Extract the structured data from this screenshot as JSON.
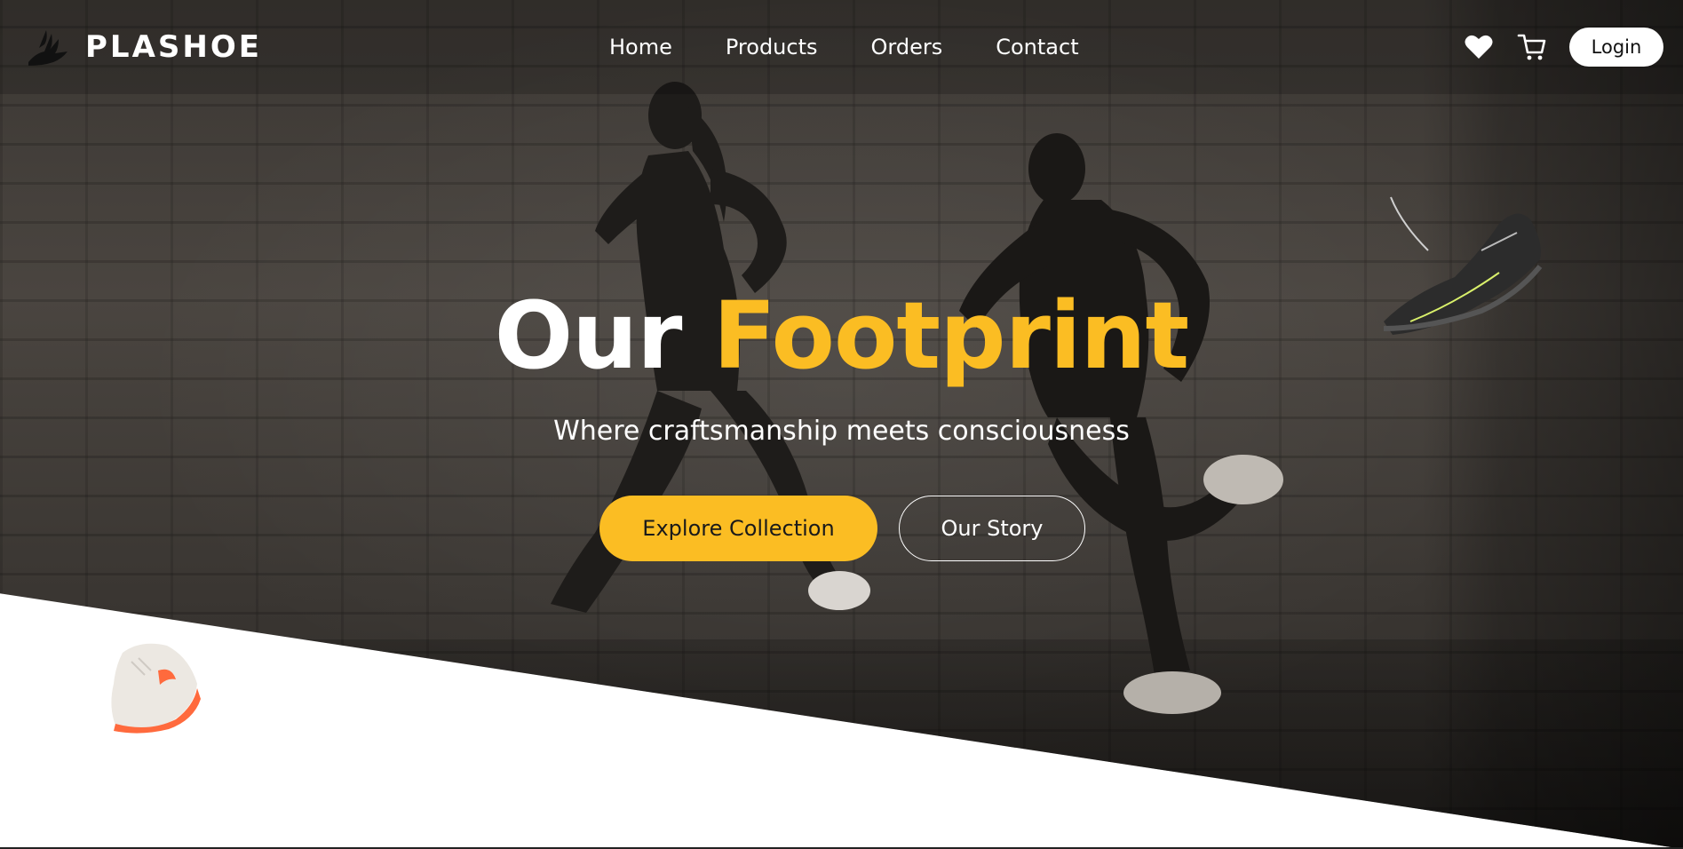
{
  "brand": {
    "name": "PLASHOE",
    "logo_icon": "winged-shoe-icon"
  },
  "nav": {
    "links": [
      "Home",
      "Products",
      "Orders",
      "Contact"
    ],
    "wishlist_icon": "heart-icon",
    "cart_icon": "cart-icon",
    "login_label": "Login"
  },
  "hero": {
    "title_part1": "Our",
    "title_part2": "Footprint",
    "subtitle": "Where craftsmanship meets consciousness",
    "primary_cta": "Explore Collection",
    "secondary_cta": "Our Story"
  },
  "colors": {
    "accent": "#fbbd23",
    "text_light": "#ffffff",
    "background": "#ffffff",
    "hero_overlay": "#3b3733"
  }
}
